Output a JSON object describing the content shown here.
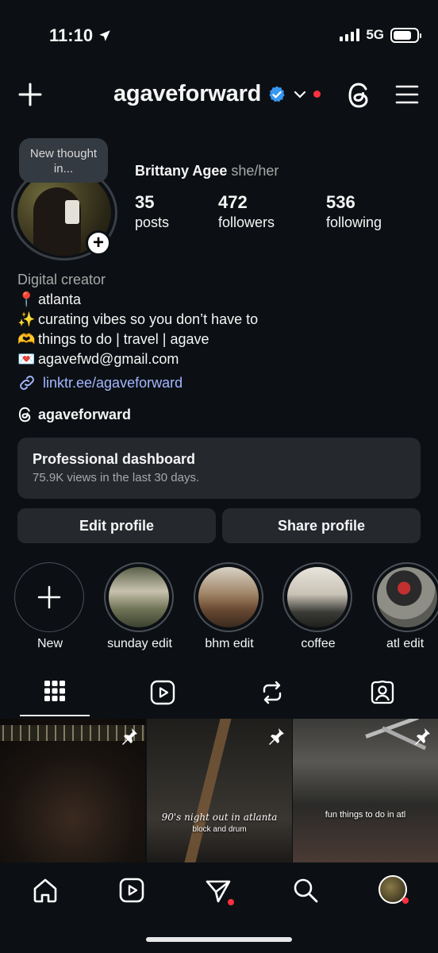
{
  "status": {
    "time": "11:10",
    "network": "5G"
  },
  "header": {
    "username": "agaveforward"
  },
  "profile": {
    "thought_bubble": "New thought in...",
    "display_name": "Brittany Agee",
    "pronouns": "she/her",
    "stats": [
      {
        "value": "35",
        "label": "posts"
      },
      {
        "value": "472",
        "label": "followers"
      },
      {
        "value": "536",
        "label": "following"
      }
    ],
    "category": "Digital creator",
    "bio_lines": [
      {
        "icon": "📍",
        "text": "atlanta"
      },
      {
        "icon": "✨",
        "text": "curating vibes so you don’t have to"
      },
      {
        "icon": "🫶",
        "text": "things to do | travel | agave"
      },
      {
        "icon": "💌",
        "text": "agavefwd@gmail.com"
      }
    ],
    "link": "linktr.ee/agaveforward",
    "threads_handle": "agaveforward"
  },
  "dashboard": {
    "title": "Professional dashboard",
    "subtitle": "75.9K views in the last 30 days."
  },
  "actions": {
    "edit": "Edit profile",
    "share": "Share profile"
  },
  "highlights": [
    "New",
    "sunday edit",
    "bhm edit",
    "coffee",
    "atl edit"
  ],
  "posts": [
    {
      "caption": "",
      "subcaption": ""
    },
    {
      "caption": "90's night out in atlanta",
      "subcaption": "block and drum"
    },
    {
      "caption": "fun things to do in atl",
      "subcaption": ""
    }
  ],
  "colors": {
    "background": "#0c1014",
    "surface": "#25292e",
    "link": "#a3b6ff",
    "verified": "#3897f0",
    "notification": "#ff3040"
  }
}
